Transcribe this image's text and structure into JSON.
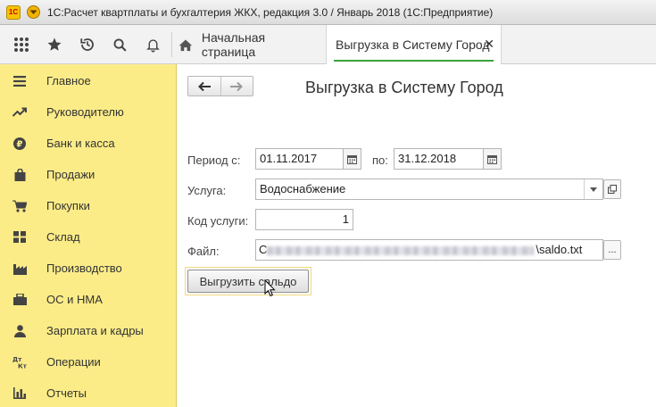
{
  "window": {
    "title": "1С:Расчет квартплаты и бухгалтерия ЖКХ, редакция 3.0 / Январь 2018  (1С:Предприятие)",
    "logo_text": "1С"
  },
  "toolbar": {
    "icons": [
      "apps-grid-icon",
      "star-icon",
      "history-icon",
      "search-icon",
      "bell-icon"
    ],
    "tabs": [
      {
        "label": "Начальная страница",
        "icon": "home-icon"
      },
      {
        "label": "Выгрузка в Систему Город",
        "active": true,
        "close": "✕"
      }
    ]
  },
  "sidebar": {
    "items": [
      {
        "label": "Главное",
        "icon": "hamburger-icon"
      },
      {
        "label": "Руководителю",
        "icon": "trend-icon"
      },
      {
        "label": "Банк и касса",
        "icon": "ruble-icon"
      },
      {
        "label": "Продажи",
        "icon": "bag-icon"
      },
      {
        "label": "Покупки",
        "icon": "cart-icon"
      },
      {
        "label": "Склад",
        "icon": "warehouse-icon"
      },
      {
        "label": "Производство",
        "icon": "factory-icon"
      },
      {
        "label": "ОС и НМА",
        "icon": "fixed-assets-icon"
      },
      {
        "label": "Зарплата и кадры",
        "icon": "person-icon"
      },
      {
        "label": "Операции",
        "icon": "dt-kt-icon"
      },
      {
        "label": "Отчеты",
        "icon": "bar-chart-icon"
      }
    ]
  },
  "form": {
    "title": "Выгрузка в Систему Город",
    "period_from_label": "Период с:",
    "period_from_value": "01.11.2017",
    "period_to_label": "по:",
    "period_to_value": "31.12.2018",
    "service_label": "Услуга:",
    "service_value": "Водоснабжение",
    "service_code_label": "Код услуги:",
    "service_code_value": "1",
    "file_label": "Файл:",
    "file_prefix": "C",
    "file_suffix": "\\saldo.txt",
    "file_browse": "...",
    "submit_label": "Выгрузить сальдо"
  },
  "colors": {
    "sidebar_bg": "#fbec88",
    "active_tab_accent": "#3aa33a"
  }
}
